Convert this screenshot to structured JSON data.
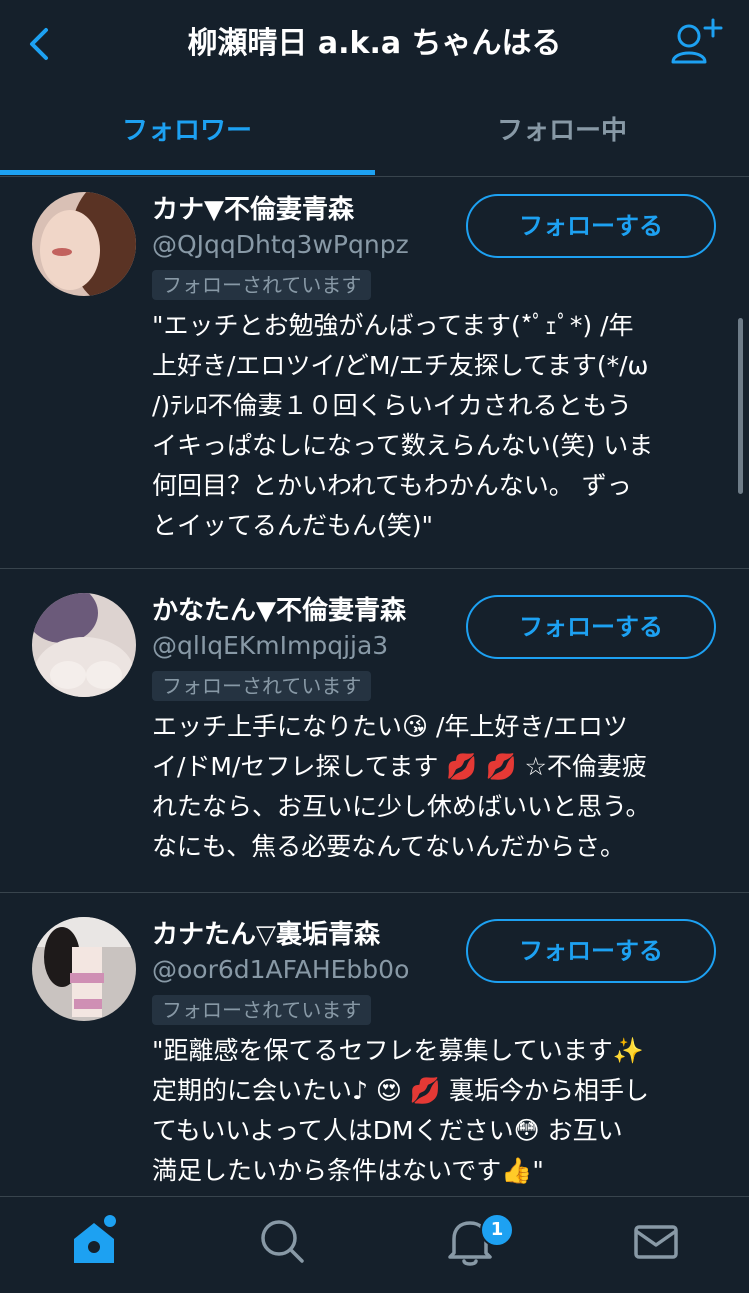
{
  "header": {
    "title": "柳瀬晴日 a.k.a ちゃんはる",
    "back_icon": "chevron-left-icon",
    "add_icon": "add-user-icon"
  },
  "tabs": [
    {
      "label": "フォロワー",
      "active": true
    },
    {
      "label": "フォロー中",
      "active": false
    }
  ],
  "users": [
    {
      "name": "カナ▼不倫妻青森",
      "handle": "@QJqqDhtq3wPqnpz",
      "badge": "フォローされています",
      "follow_label": "フォローする",
      "bio": "\"エッチとお勉強がんばってます(*ﾟｪﾟ*) /年\n上好き/エロツイ/どM/エチ友探してます(*/ω\n/)ﾃﾚﾛ不倫妻１０回くらいイカされるともう\nイキっぱなしになって数えらんない(笑) いま\n何回目？とかいわれてもわかんない。 ずっ\nとイッてるんだもん(笑)\""
    },
    {
      "name": "かなたん▼不倫妻青森",
      "handle": "@qlIqEKmImpqjja3",
      "badge": "フォローされています",
      "follow_label": "フォローする",
      "bio": "エッチ上手になりたい😘 /年上好き/エロツ\nイ/ドM/セフレ探してます 💋 💋 ☆不倫妻疲\nれたなら、お互いに少し休めばいいと思う。\nなにも、焦る必要なんてないんだからさ。"
    },
    {
      "name": "カナたん▽裏垢青森",
      "handle": "@oor6d1AFAHEbb0o",
      "badge": "フォローされています",
      "follow_label": "フォローする",
      "bio": "\"距離感を保てるセフレを募集しています✨\n定期的に会いたい♪ 😍 💋 裏垢今から相手し\nてもいいよって人はDMください😳 お互い\n満足したいから条件はないです👍\""
    }
  ],
  "tabbar": {
    "items": [
      "home-icon",
      "search-icon",
      "bell-icon",
      "mail-icon"
    ],
    "notification_count": "1"
  },
  "colors": {
    "background": "#15202b",
    "accent": "#1da1f2",
    "secondary_text": "#8899a6",
    "divider": "#38444d"
  }
}
